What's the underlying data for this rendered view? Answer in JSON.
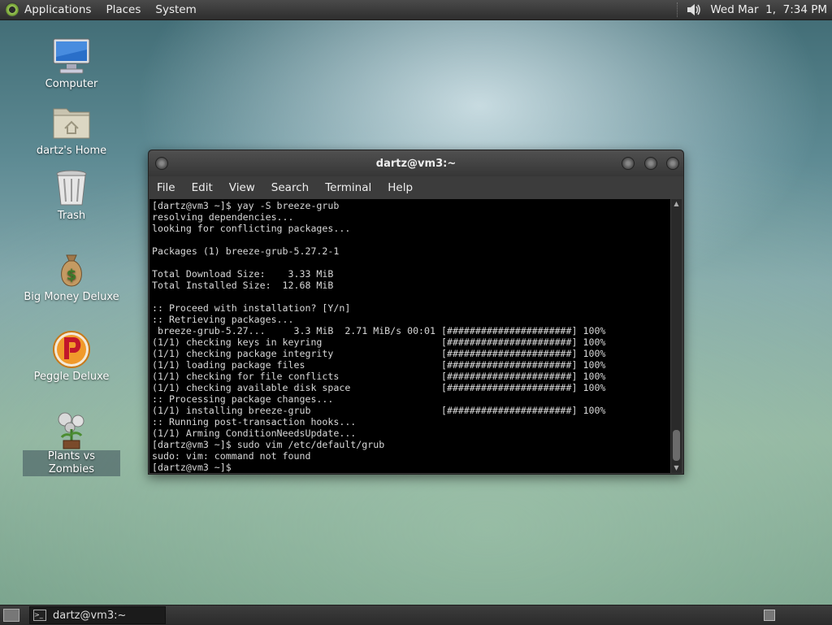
{
  "top_panel": {
    "menus": [
      "Applications",
      "Places",
      "System"
    ],
    "clock": "Wed Mar  1,  7:34 PM"
  },
  "desktop": {
    "icons": [
      {
        "label": "Computer",
        "icon": "computer-icon"
      },
      {
        "label": "dartz's Home",
        "icon": "home-folder-icon"
      },
      {
        "label": "Trash",
        "icon": "trash-icon"
      },
      {
        "label": "Big Money Deluxe",
        "icon": "money-bag-icon"
      },
      {
        "label": "Peggle Deluxe",
        "icon": "peggle-icon"
      },
      {
        "label": "Plants vs Zombies",
        "icon": "plants-vs-zombies-icon"
      }
    ]
  },
  "terminal": {
    "title": "dartz@vm3:~",
    "menus": [
      "File",
      "Edit",
      "View",
      "Search",
      "Terminal",
      "Help"
    ],
    "lines": [
      "[dartz@vm3 ~]$ yay -S breeze-grub",
      "resolving dependencies...",
      "looking for conflicting packages...",
      "",
      "Packages (1) breeze-grub-5.27.2-1",
      "",
      "Total Download Size:    3.33 MiB",
      "Total Installed Size:  12.68 MiB",
      "",
      ":: Proceed with installation? [Y/n]",
      ":: Retrieving packages...",
      " breeze-grub-5.27...     3.3 MiB  2.71 MiB/s 00:01 [######################] 100%",
      "(1/1) checking keys in keyring                     [######################] 100%",
      "(1/1) checking package integrity                   [######################] 100%",
      "(1/1) loading package files                        [######################] 100%",
      "(1/1) checking for file conflicts                  [######################] 100%",
      "(1/1) checking available disk space                [######################] 100%",
      ":: Processing package changes...",
      "(1/1) installing breeze-grub                       [######################] 100%",
      ":: Running post-transaction hooks...",
      "(1/1) Arming ConditionNeedsUpdate...",
      "[dartz@vm3 ~]$ sudo vim /etc/default/grub",
      "sudo: vim: command not found",
      "[dartz@vm3 ~]$ "
    ]
  },
  "taskbar": {
    "tasks": [
      {
        "label": "dartz@vm3:~",
        "icon": "terminal-icon"
      }
    ]
  }
}
